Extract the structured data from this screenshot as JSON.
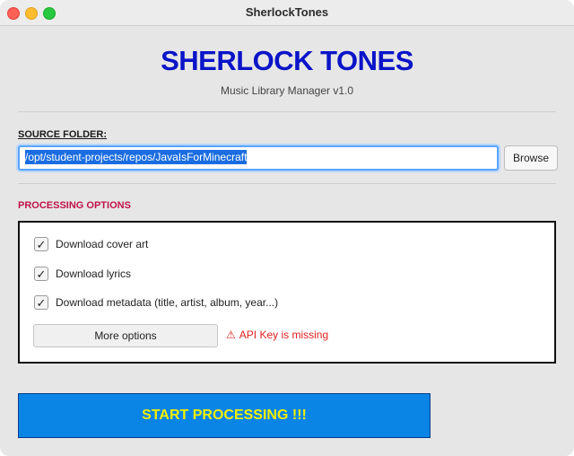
{
  "window": {
    "title": "SherlockTones"
  },
  "header": {
    "app_title": "SHERLOCK TONES",
    "subtitle": "Music Library Manager v1.0"
  },
  "source": {
    "label": "SOURCE FOLDER:",
    "path_value": "/opt/student-projects/repos/JavaIsForMinecraft",
    "browse_label": "Browse"
  },
  "options": {
    "label": "PROCESSING OPTIONS",
    "items": [
      {
        "label": "Download cover art",
        "checked": true
      },
      {
        "label": "Download lyrics",
        "checked": true
      },
      {
        "label": "Download metadata (title, artist, album, year...)",
        "checked": true
      }
    ],
    "more_label": "More options",
    "warning_icon": "⚠",
    "warning_text": "API Key is missing"
  },
  "start": {
    "label": "START PROCESSING !!!"
  },
  "colors": {
    "title_blue": "#0a14c8",
    "section_red": "#c0134a",
    "start_bg": "#0a85e6",
    "start_text": "#f5f000",
    "warning": "#e02020"
  }
}
